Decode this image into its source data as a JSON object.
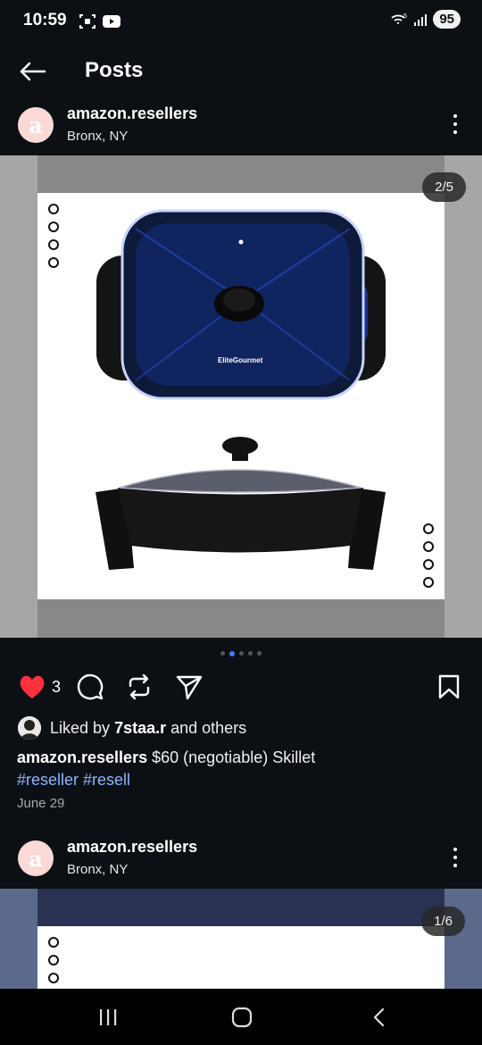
{
  "status_bar": {
    "time": "10:59",
    "battery": "95",
    "icons": [
      "screenshot-icon",
      "youtube-icon",
      "wifi-icon",
      "signal-icon"
    ]
  },
  "header": {
    "title": "Posts",
    "back_icon": "back-arrow-icon"
  },
  "posts": [
    {
      "username": "amazon.resellers",
      "location": "Bronx, NY",
      "avatar_letter": "a",
      "counter": "2/5",
      "likes": "3",
      "liked_by_prefix": "Liked by",
      "liked_by_user": "7staa.r",
      "liked_by_suffix": "and others",
      "caption_user": "amazon.resellers",
      "caption_text": "$60 (negotiable) Skillet",
      "hashtags": "#reseller #resell",
      "date": "June 29",
      "product_brand": "EliteGourmet"
    },
    {
      "username": "amazon.resellers",
      "location": "Bronx, NY",
      "avatar_letter": "a",
      "counter": "1/6"
    }
  ],
  "colors": {
    "background": "#0c1014",
    "like": "#ff3040",
    "hashtag": "#8ab4ff",
    "active_dot": "#3b82f6",
    "avatar": "#fbd9d6"
  },
  "carousel": {
    "total": 5,
    "active": 1
  }
}
